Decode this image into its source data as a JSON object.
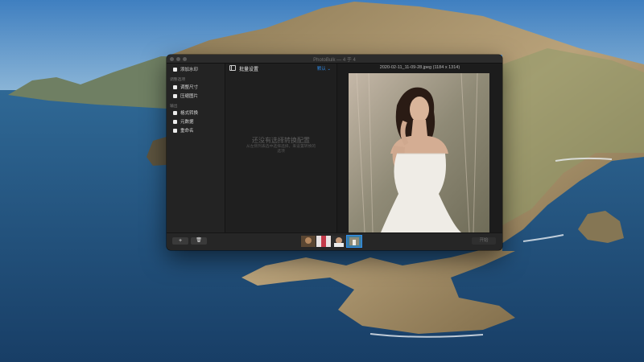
{
  "window": {
    "title": "PhotoBulk — 4 于 4"
  },
  "sidebar": {
    "items": [
      {
        "label": "添加水印"
      },
      {
        "label": "调整尺寸"
      },
      {
        "label": "压缩图片"
      },
      {
        "label": "格式转换"
      },
      {
        "label": "元数据"
      },
      {
        "label": "重命名"
      }
    ],
    "groups": [
      "调整选项",
      "输出"
    ]
  },
  "settings": {
    "title": "批量设置",
    "preset": "默认 ⌄",
    "empty_title": "还没有选择转换配置",
    "empty_subtitle": "从左侧列表选中选择选择，来设置转换的选项"
  },
  "preview": {
    "caption": "2020-02-11_11-09-28.jpeg (1184 x 1314)"
  },
  "bottombar": {
    "add_label": "+",
    "delete_label": "🗑",
    "start_label": "开始",
    "thumbnail_count": 4,
    "selected_thumbnail": 4
  },
  "colors": {
    "accent": "#2f8ff0",
    "window_bg": "#1f1f1f",
    "sidebar_bg": "#232323"
  }
}
